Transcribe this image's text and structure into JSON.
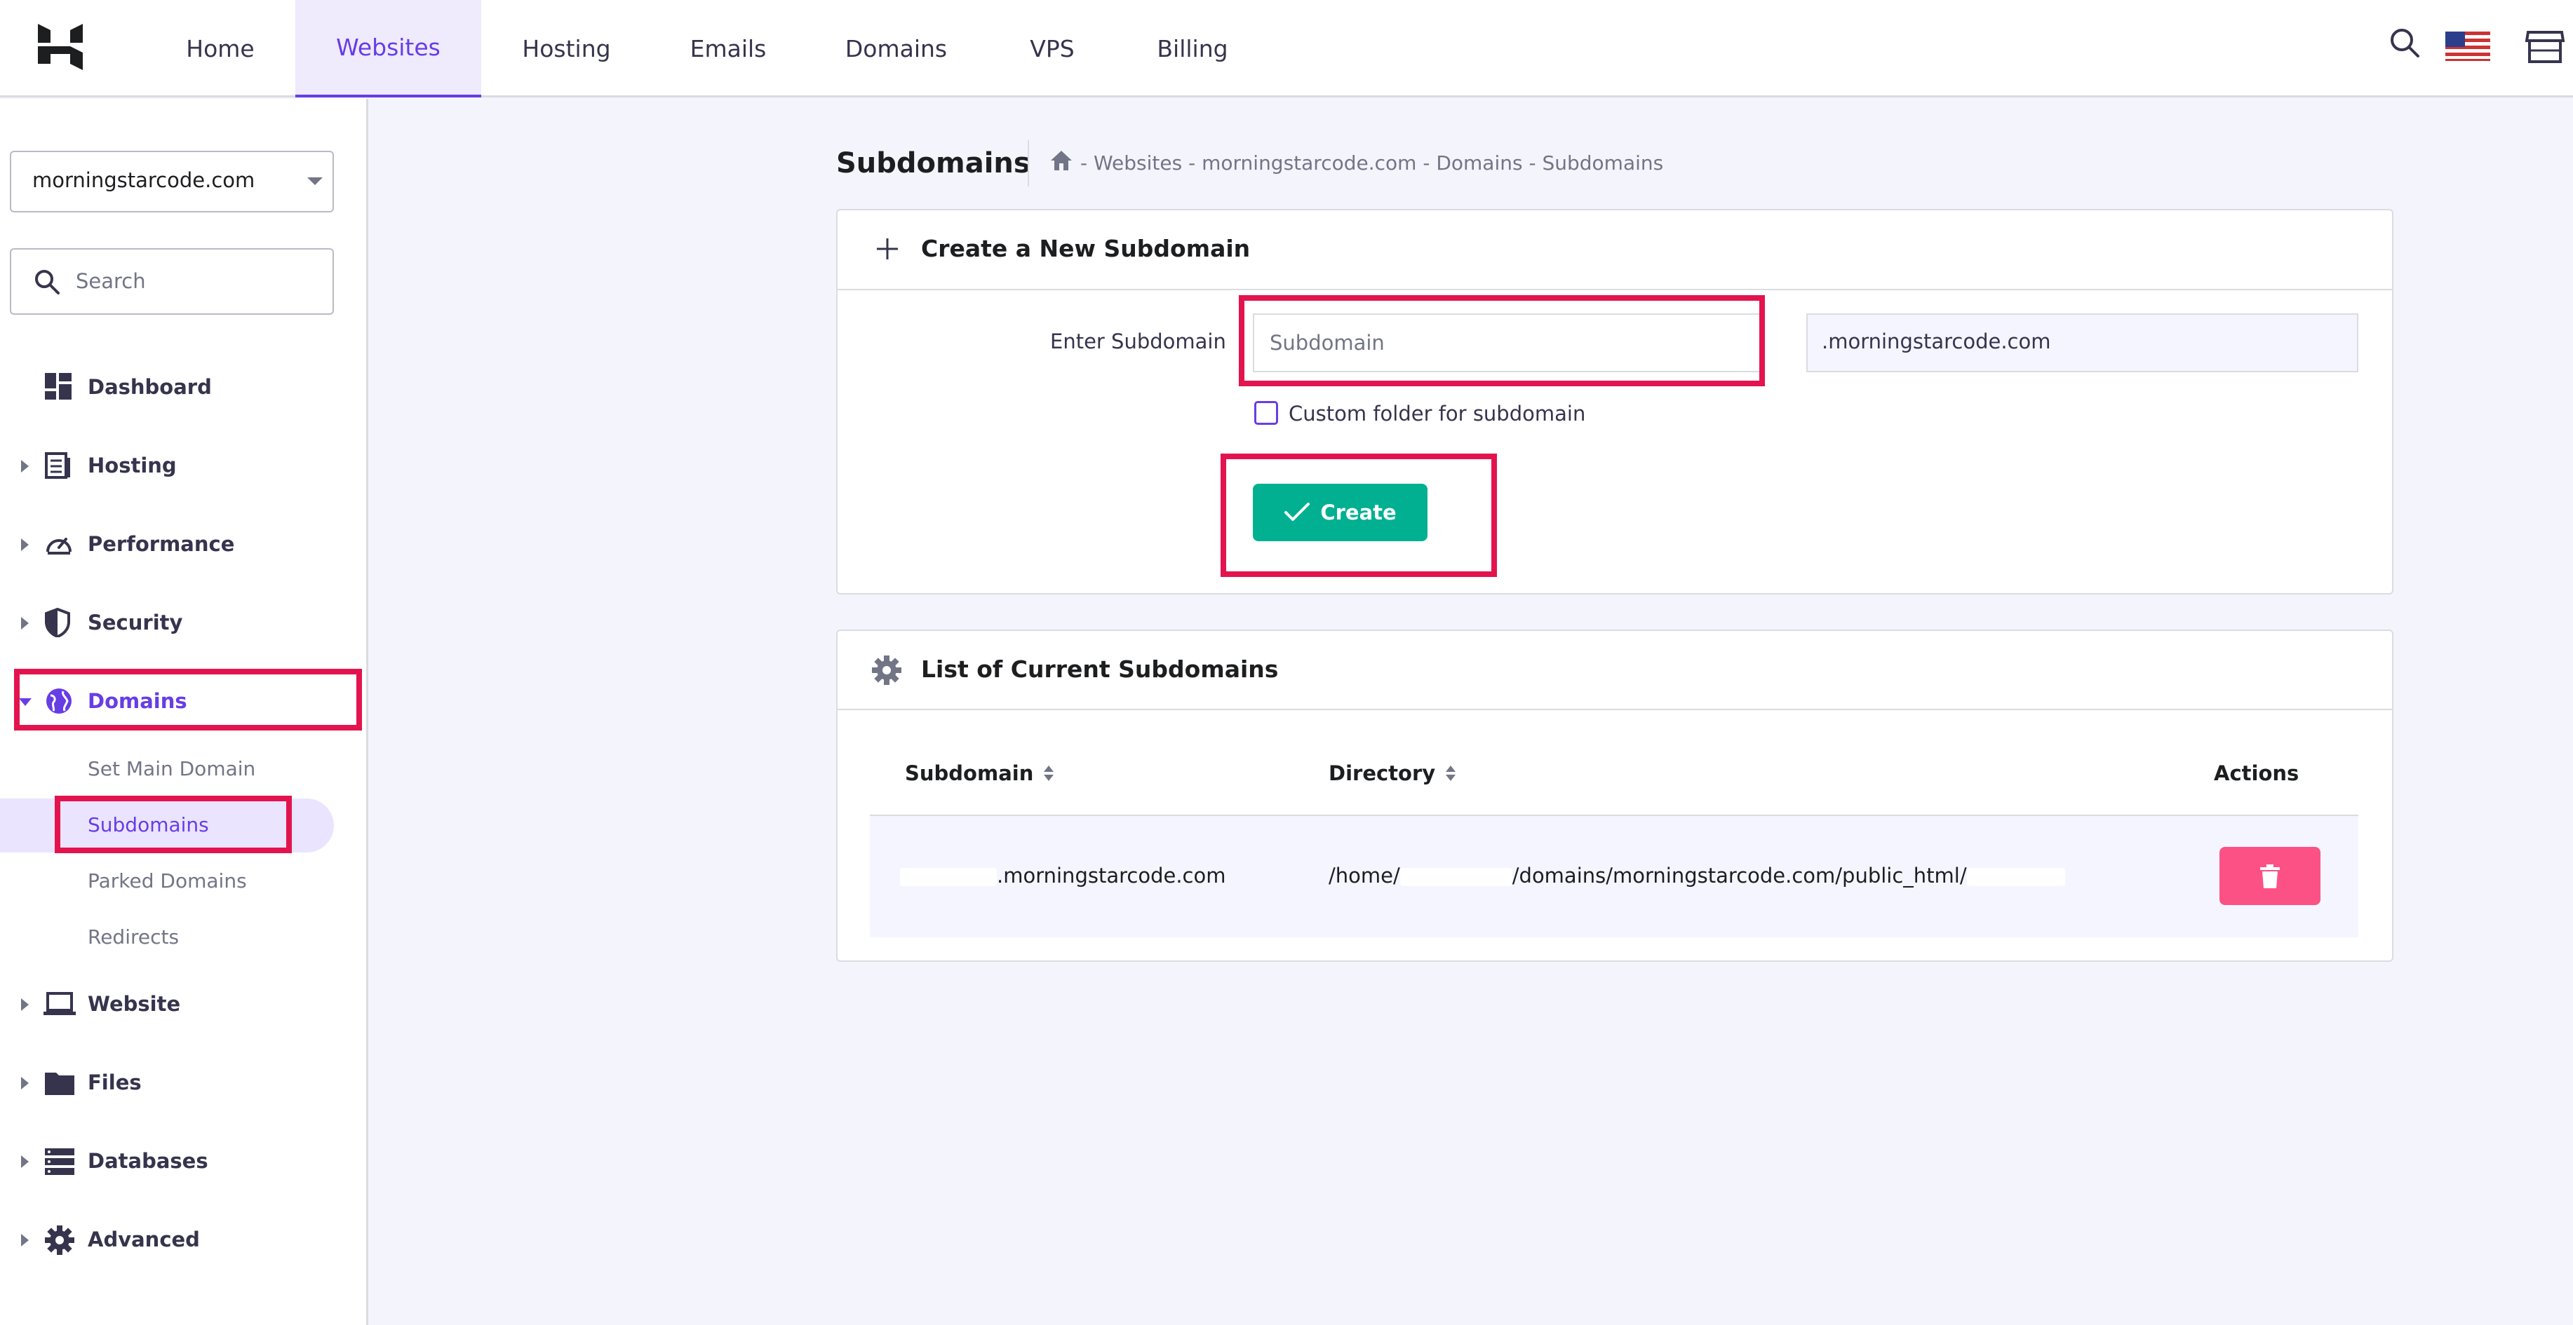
{
  "topnav": {
    "items": [
      {
        "label": "Home"
      },
      {
        "label": "Websites"
      },
      {
        "label": "Hosting"
      },
      {
        "label": "Emails"
      },
      {
        "label": "Domains"
      },
      {
        "label": "VPS"
      },
      {
        "label": "Billing"
      }
    ],
    "active": "Websites"
  },
  "sidebar": {
    "site_select": "morningstarcode.com",
    "search_placeholder": "Search",
    "items": [
      {
        "label": "Dashboard",
        "icon": "dashboard-icon"
      },
      {
        "label": "Hosting",
        "icon": "server-icon"
      },
      {
        "label": "Performance",
        "icon": "speedometer-icon"
      },
      {
        "label": "Security",
        "icon": "shield-icon"
      },
      {
        "label": "Domains",
        "icon": "globe-icon",
        "expanded": true
      },
      {
        "label": "Website",
        "icon": "laptop-icon"
      },
      {
        "label": "Files",
        "icon": "folder-icon"
      },
      {
        "label": "Databases",
        "icon": "database-icon"
      },
      {
        "label": "Advanced",
        "icon": "gear-icon"
      }
    ],
    "domains_sub": [
      {
        "label": "Set Main Domain"
      },
      {
        "label": "Subdomains"
      },
      {
        "label": "Parked Domains"
      },
      {
        "label": "Redirects"
      }
    ],
    "active_sub": "Subdomains"
  },
  "page": {
    "title": "Subdomains",
    "breadcrumb": "- Websites - morningstarcode.com - Domains - Subdomains"
  },
  "create_card": {
    "title": "Create a New Subdomain",
    "field_label": "Enter Subdomain",
    "input_placeholder": "Subdomain",
    "input_value": "",
    "suffix": ".morningstarcode.com",
    "checkbox_label": "Custom folder for subdomain",
    "checkbox_checked": false,
    "create_label": "Create"
  },
  "list_card": {
    "title": "List of Current Subdomains",
    "columns": [
      "Subdomain",
      "Directory",
      "Actions"
    ],
    "rows": [
      {
        "subdomain_suffix": ".morningstarcode.com",
        "directory_prefix": "/home/",
        "directory_mid": "/domains/morningstarcode.com/public_html/"
      }
    ]
  },
  "colors": {
    "accent": "#673de6",
    "highlight": "#e3134e",
    "create": "#00b090",
    "delete": "#fc5185"
  }
}
